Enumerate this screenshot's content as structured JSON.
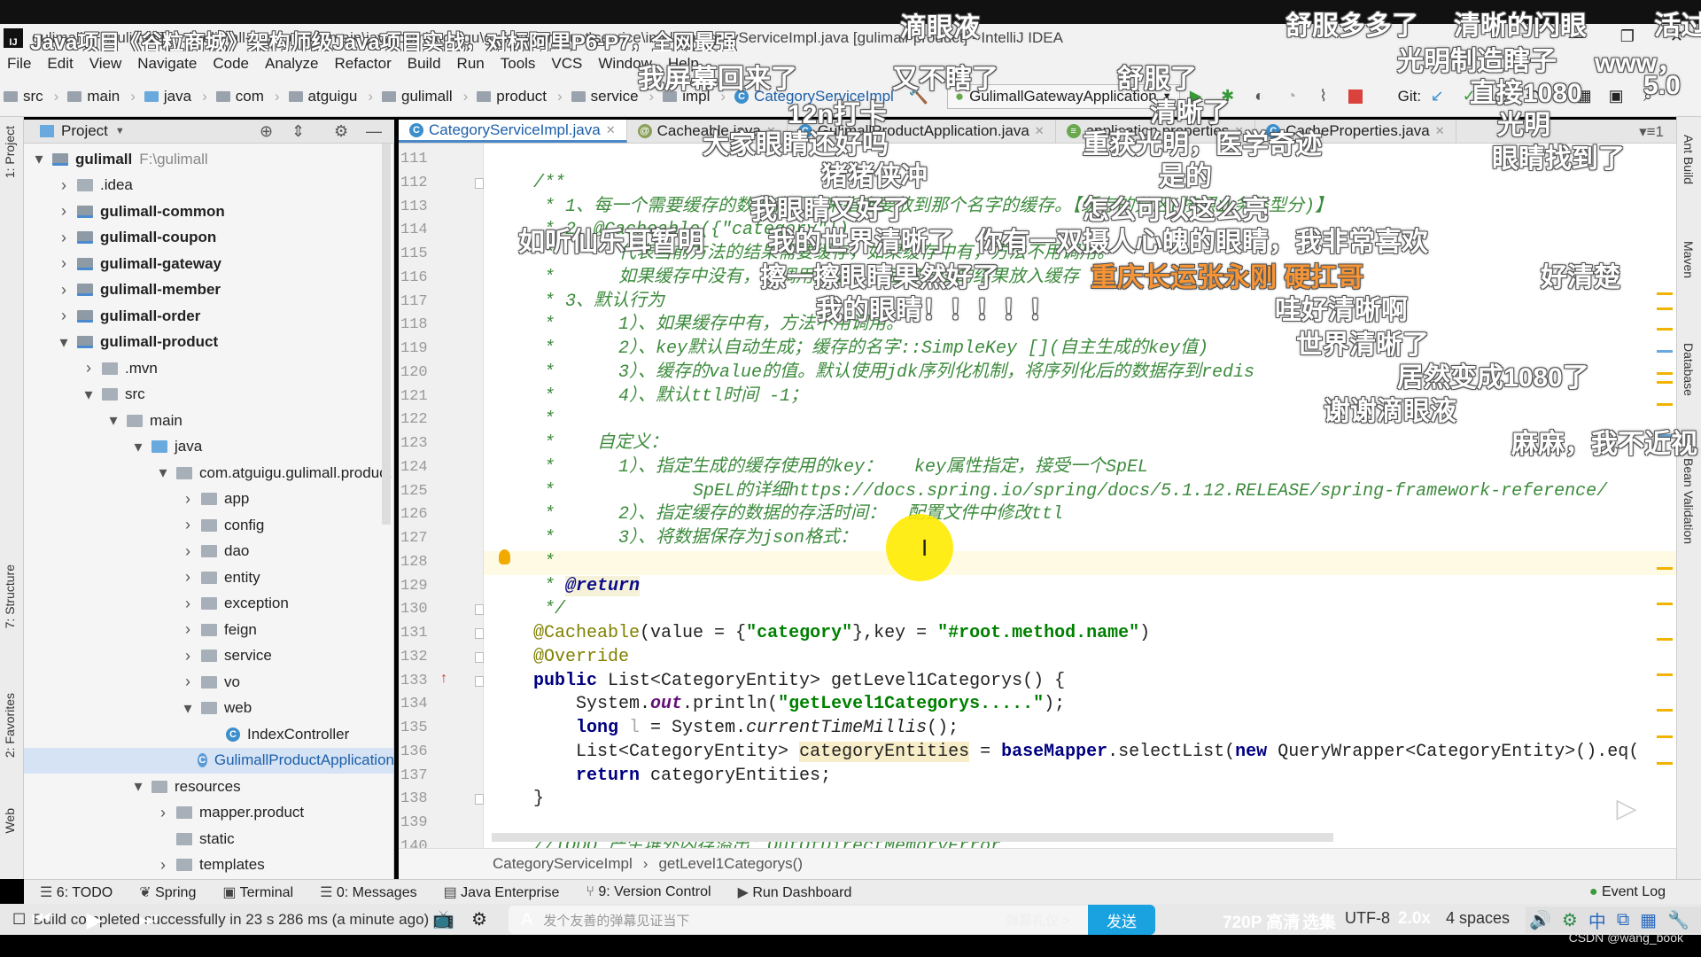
{
  "window": {
    "title": "gulimall [F:\\gulimall] - ...\\gulimall-product\\src\\main\\java\\com\\atguigu\\gulimall\\product\\service\\impl\\CategoryServiceImpl.java [gulimall-product] - IntelliJ IDEA",
    "video_title": "Java项目《谷粒商城》架构师级Java项目实战，对标阿里P6-P7，全网最强"
  },
  "menu": [
    "File",
    "Edit",
    "View",
    "Navigate",
    "Code",
    "Analyze",
    "Refactor",
    "Build",
    "Run",
    "Tools",
    "VCS",
    "Window",
    "Help"
  ],
  "navbar": {
    "crumbs": [
      "src",
      "main",
      "java",
      "com",
      "atguigu",
      "gulimall",
      "product",
      "service",
      "impl",
      "CategoryServiceImpl"
    ],
    "run_config": "GulimallGatewayApplication",
    "git_label": "Git:"
  },
  "project": {
    "header": "Project",
    "tree": [
      {
        "label": "gulimall",
        "path": "F:\\gulimall",
        "level": 0,
        "state": "open",
        "icon": "module",
        "bold": true
      },
      {
        "label": ".idea",
        "level": 1,
        "state": "closed",
        "icon": "folder"
      },
      {
        "label": "gulimall-common",
        "level": 1,
        "state": "closed",
        "icon": "module",
        "bold": true
      },
      {
        "label": "gulimall-coupon",
        "level": 1,
        "state": "closed",
        "icon": "module",
        "bold": true
      },
      {
        "label": "gulimall-gateway",
        "level": 1,
        "state": "closed",
        "icon": "module",
        "bold": true
      },
      {
        "label": "gulimall-member",
        "level": 1,
        "state": "closed",
        "icon": "module",
        "bold": true
      },
      {
        "label": "gulimall-order",
        "level": 1,
        "state": "closed",
        "icon": "module",
        "bold": true
      },
      {
        "label": "gulimall-product",
        "level": 1,
        "state": "open",
        "icon": "module",
        "bold": true
      },
      {
        "label": ".mvn",
        "level": 2,
        "state": "closed",
        "icon": "folder"
      },
      {
        "label": "src",
        "level": 2,
        "state": "open",
        "icon": "folder"
      },
      {
        "label": "main",
        "level": 3,
        "state": "open",
        "icon": "folder"
      },
      {
        "label": "java",
        "level": 4,
        "state": "open",
        "icon": "source-folder"
      },
      {
        "label": "com.atguigu.gulimall.product",
        "level": 5,
        "state": "open",
        "icon": "package"
      },
      {
        "label": "app",
        "level": 6,
        "state": "closed",
        "icon": "package"
      },
      {
        "label": "config",
        "level": 6,
        "state": "closed",
        "icon": "package"
      },
      {
        "label": "dao",
        "level": 6,
        "state": "closed",
        "icon": "package"
      },
      {
        "label": "entity",
        "level": 6,
        "state": "closed",
        "icon": "package"
      },
      {
        "label": "exception",
        "level": 6,
        "state": "closed",
        "icon": "package"
      },
      {
        "label": "feign",
        "level": 6,
        "state": "closed",
        "icon": "package"
      },
      {
        "label": "service",
        "level": 6,
        "state": "closed",
        "icon": "package"
      },
      {
        "label": "vo",
        "level": 6,
        "state": "closed",
        "icon": "package"
      },
      {
        "label": "web",
        "level": 6,
        "state": "open",
        "icon": "package"
      },
      {
        "label": "IndexController",
        "level": 7,
        "state": "leaf",
        "icon": "class"
      },
      {
        "label": "GulimallProductApplication",
        "level": 6,
        "state": "leaf",
        "icon": "spring-class",
        "selected": true
      },
      {
        "label": "resources",
        "level": 4,
        "state": "open",
        "icon": "folder"
      },
      {
        "label": "mapper.product",
        "level": 5,
        "state": "closed",
        "icon": "folder"
      },
      {
        "label": "static",
        "level": 5,
        "state": "leaf",
        "icon": "folder"
      },
      {
        "label": "templates",
        "level": 5,
        "state": "closed",
        "icon": "folder"
      }
    ]
  },
  "tabs": [
    {
      "label": "CategoryServiceImpl.java",
      "icon": "class",
      "active": true
    },
    {
      "label": "Cacheable.java",
      "icon": "annotation"
    },
    {
      "label": "GulimallProductApplication.java",
      "icon": "spring-class"
    },
    {
      "label": "application.properties",
      "icon": "properties"
    },
    {
      "label": "CacheProperties.java",
      "icon": "class"
    }
  ],
  "editor": {
    "current_line": 128,
    "lines": [
      {
        "n": 111,
        "s": []
      },
      {
        "n": 112,
        "s": [
          [
            "/**",
            "c"
          ]
        ]
      },
      {
        "n": 113,
        "s": [
          [
            " * 1、每一个需要缓存的数据我们都来指定要放到那个名字的缓存。【缓存的分区(按照业务类型分)】",
            "c"
          ]
        ]
      },
      {
        "n": 114,
        "s": [
          [
            " * 2、@Cacheable({\"category\"})",
            "c"
          ]
        ]
      },
      {
        "n": 115,
        "s": [
          [
            " *      代表当前方法的结果需要缓存，如果缓存中有，方法不用调用。",
            "c"
          ]
        ]
      },
      {
        "n": 116,
        "s": [
          [
            " *      如果缓存中没有，会调用方法，最后将方法的结果放入缓存",
            "c"
          ]
        ]
      },
      {
        "n": 117,
        "s": [
          [
            " * 3、默认行为",
            "c"
          ]
        ]
      },
      {
        "n": 118,
        "s": [
          [
            " *      1）、如果缓存中有，方法不用调用。",
            "c"
          ]
        ]
      },
      {
        "n": 119,
        "s": [
          [
            " *      2）、key默认自动生成；缓存的名字::SimpleKey [](自主生成的key值)",
            "c"
          ]
        ]
      },
      {
        "n": 120,
        "s": [
          [
            " *      3）、缓存的value的值。默认使用jdk序列化机制，将序列化后的数据存到redis",
            "c"
          ]
        ]
      },
      {
        "n": 121,
        "s": [
          [
            " *      4）、默认ttl时间 -1；",
            "c"
          ]
        ]
      },
      {
        "n": 122,
        "s": [
          [
            " *",
            "c"
          ]
        ]
      },
      {
        "n": 123,
        "s": [
          [
            " *    自定义：",
            "c"
          ]
        ]
      },
      {
        "n": 124,
        "s": [
          [
            " *      1）、指定生成的缓存使用的key：   key属性指定，接受一个SpEL",
            "c"
          ]
        ]
      },
      {
        "n": 125,
        "s": [
          [
            " *             SpEL的详细https://docs.spring.io/spring/docs/5.1.12.RELEASE/spring-framework-reference/",
            "c"
          ]
        ]
      },
      {
        "n": 126,
        "s": [
          [
            " *      2）、指定缓存的数据的存活时间：  配置文件中修改ttl",
            "c"
          ]
        ]
      },
      {
        "n": 127,
        "s": [
          [
            " *      3）、将数据保存为json格式：",
            "c"
          ]
        ]
      },
      {
        "n": 128,
        "s": [
          [
            " *",
            "c"
          ]
        ]
      },
      {
        "n": 129,
        "s": [
          [
            " * ",
            "c"
          ],
          [
            "@return",
            "ct"
          ]
        ]
      },
      {
        "n": 130,
        "s": [
          [
            " */",
            "c"
          ]
        ]
      },
      {
        "n": 131,
        "s": [
          [
            "@Cacheable",
            "ann"
          ],
          [
            "(value = {",
            ""
          ],
          [
            "\"category\"",
            "str"
          ],
          [
            "},key = ",
            ""
          ],
          [
            "\"#root.method.name\"",
            "str"
          ],
          [
            ")",
            ""
          ]
        ]
      },
      {
        "n": 132,
        "s": [
          [
            "@Override",
            "ann"
          ]
        ]
      },
      {
        "n": 133,
        "s": [
          [
            "public ",
            "kw"
          ],
          [
            "List<CategoryEntity> getLevel1Categorys() {",
            ""
          ]
        ]
      },
      {
        "n": 134,
        "s": [
          [
            "    System.",
            ""
          ],
          [
            "out",
            "f"
          ],
          [
            ".println(",
            ""
          ],
          [
            "\"getLevel1Categorys.....\"",
            "str"
          ],
          [
            ");",
            ""
          ]
        ]
      },
      {
        "n": 135,
        "s": [
          [
            "    ",
            ""
          ],
          [
            "long ",
            "kw"
          ],
          [
            "l",
            "gr"
          ],
          [
            " = System.",
            ""
          ],
          [
            "currentTimeMillis",
            "it"
          ],
          [
            "();",
            ""
          ]
        ]
      },
      {
        "n": 136,
        "s": [
          [
            "    List<CategoryEntity> ",
            ""
          ],
          [
            "categoryEntities",
            "hl"
          ],
          [
            " = ",
            ""
          ],
          [
            "baseMapper",
            "m"
          ],
          [
            ".selectList(",
            ""
          ],
          [
            "new ",
            "kw"
          ],
          [
            "QueryWrapper<CategoryEntity>().eq(",
            ""
          ]
        ]
      },
      {
        "n": 137,
        "s": [
          [
            "    ",
            ""
          ],
          [
            "return ",
            "kw"
          ],
          [
            "categoryEntities;",
            ""
          ]
        ]
      },
      {
        "n": 138,
        "s": [
          [
            "}",
            ""
          ]
        ]
      },
      {
        "n": 139,
        "s": []
      },
      {
        "n": 140,
        "s": [
          [
            "//TODO 产生堆外内存溢出：OutOfDirectMemoryError",
            "c"
          ]
        ]
      }
    ]
  },
  "breadcrumb": [
    "CategoryServiceImpl",
    "getLevel1Categorys()"
  ],
  "tool_windows": {
    "left": [
      "1: Project",
      "7: Structure",
      "2: Favorites",
      "Web"
    ],
    "right": [
      "Ant Build",
      "Maven",
      "Database",
      "Bean Validation"
    ],
    "bottom": [
      "6: TODO",
      "Spring",
      "Terminal",
      "0: Messages",
      "Java Enterprise",
      "9: Version Control",
      "Run Dashboard"
    ],
    "event_log": "Event Log"
  },
  "status": {
    "message": "Build completed successfully in 23 s 286 ms (a minute ago)",
    "indent": "4 spaces",
    "encoding": "UTF-8"
  },
  "player": {
    "danmaku_placeholder": "发个友善的弹幕见证当下",
    "etiquette": "弹幕礼仪 >",
    "send": "发送",
    "quality": "720P 高清",
    "episodes": "选集",
    "speed": "2.0x",
    "watermark": "CSDN @wang_book"
  },
  "danmaku": [
    {
      "text": "滴眼液"
    },
    {
      "text": "舒服多多了"
    },
    {
      "text": "清晰的闪眼"
    },
    {
      "text": "活过来"
    },
    {
      "text": "光明制造瞎子"
    },
    {
      "text": "www，"
    },
    {
      "text": "我屏幕回来了"
    },
    {
      "text": "又不瞎了"
    },
    {
      "text": "舒服了"
    },
    {
      "text": "直接1080"
    },
    {
      "text": "5.0"
    },
    {
      "text": "12n打卡"
    },
    {
      "text": "清晰了"
    },
    {
      "text": "光明"
    },
    {
      "text": "大家眼睛还好吗"
    },
    {
      "text": "重获光明，医学奇迹"
    },
    {
      "text": "眼睛找到了"
    },
    {
      "text": "猪猪侠冲"
    },
    {
      "text": "是的"
    },
    {
      "text": "我眼睛又好了"
    },
    {
      "text": "怎么可以这么亮"
    },
    {
      "text": "如听仙乐耳暂明"
    },
    {
      "text": "我的世界清晰了"
    },
    {
      "text": "你有一双摄人心魄的眼睛，我非常喜欢"
    },
    {
      "text": "擦一擦眼睛果然好了"
    },
    {
      "text": "重庆长运张永刚  硬扛哥",
      "color": "#f79434"
    },
    {
      "text": "好清楚"
    },
    {
      "text": "我的眼睛！！！！！"
    },
    {
      "text": "哇好清晰啊"
    },
    {
      "text": "世界清晰了"
    },
    {
      "text": "居然变成1080了"
    },
    {
      "text": "谢谢滴眼液"
    },
    {
      "text": "麻麻，我不近视"
    }
  ],
  "colors": {
    "accent": "#4a88c7",
    "send_button": "#1aa2e0",
    "comment": "#3d8b3d",
    "keyword": "#000080",
    "string": "#008000",
    "annotation": "#808000"
  }
}
